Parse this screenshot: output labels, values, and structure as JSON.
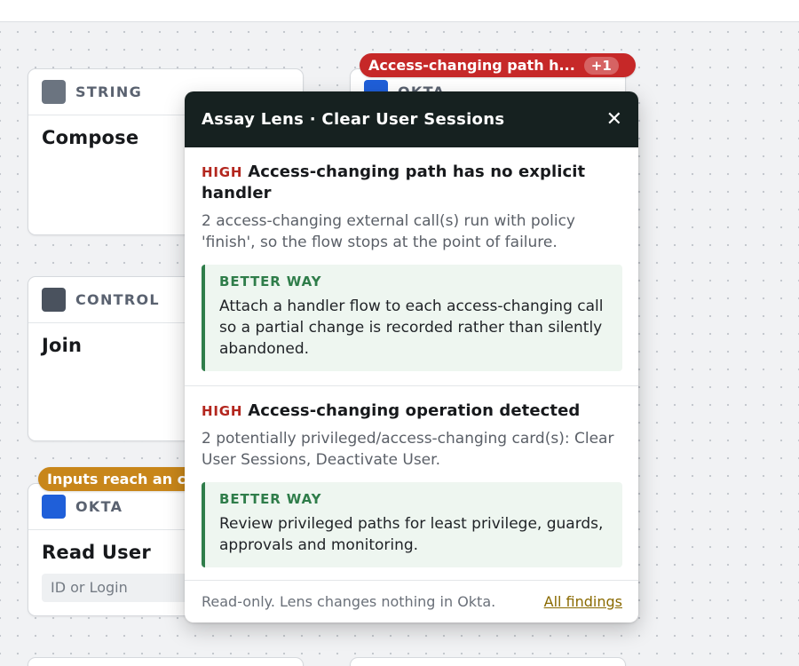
{
  "canvas": {
    "cards": [
      {
        "category": "STRING",
        "title": "Compose",
        "color": "#6b7480"
      },
      {
        "category": "CONTROL",
        "title": "Join",
        "color": "#4a525e"
      },
      {
        "category": "OKTA",
        "title": "Read User",
        "input_placeholder": "ID or Login",
        "color": "#1f5fd9"
      },
      {
        "category": "OKTA",
        "color": "#1f5fd9"
      }
    ],
    "badges": {
      "red": {
        "label": "Access-changing path h...",
        "count": "+1",
        "color": "#c62828"
      },
      "amber": {
        "label": "Inputs reach an c",
        "color": "#c8861a"
      }
    }
  },
  "lens": {
    "title": "Assay Lens · Clear User Sessions",
    "close_icon": "✕",
    "findings": [
      {
        "severity": "HIGH",
        "title": "Access-changing path has no explicit handler",
        "description": "2 access-changing external call(s) run with policy 'finish', so the flow stops at the point of failure.",
        "better_label": "BETTER WAY",
        "better_text": "Attach a handler flow to each access-changing call so a partial change is recorded rather than silently abandoned."
      },
      {
        "severity": "HIGH",
        "title": "Access-changing operation detected",
        "description": "2 potentially privileged/access-changing card(s): Clear User Sessions, Deactivate User.",
        "better_label": "BETTER WAY",
        "better_text": "Review privileged paths for least privilege, guards, approvals and monitoring."
      }
    ],
    "footer": {
      "note": "Read-only. Lens changes nothing in Okta.",
      "link": "All findings"
    }
  }
}
